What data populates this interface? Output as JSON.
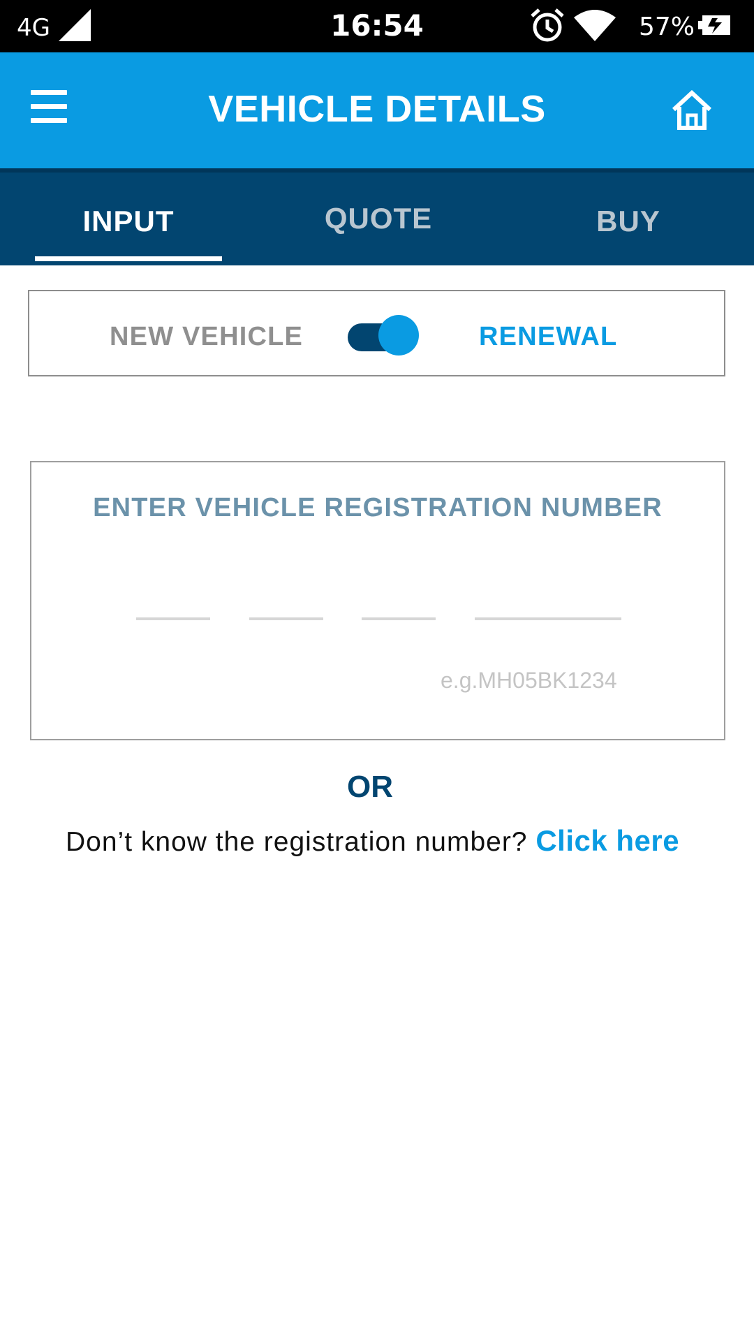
{
  "status_bar": {
    "network": "4G",
    "time": "16:54",
    "battery_percent": "57%",
    "icons": [
      "signal-icon",
      "alarm-icon",
      "wifi-icon",
      "battery-icon"
    ]
  },
  "app_bar": {
    "title": "VEHICLE DETAILS",
    "menu_icon": "menu-icon",
    "home_icon": "home-icon"
  },
  "tabs": [
    {
      "label": "INPUT",
      "active": true
    },
    {
      "label": "QUOTE",
      "active": false
    },
    {
      "label": "BUY",
      "active": false
    }
  ],
  "vehicle_type_toggle": {
    "left_label": "NEW VEHICLE",
    "right_label": "RENEWAL",
    "state": "RENEWAL"
  },
  "registration": {
    "heading": "ENTER VEHICLE REGISTRATION NUMBER",
    "fields": [
      "",
      "",
      "",
      ""
    ],
    "example": "e.g.MH05BK1234"
  },
  "alternate": {
    "or_text": "OR",
    "question": "Don’t know the registration number?",
    "link_label": "Click here"
  },
  "colors": {
    "primary": "#0a9be2",
    "dark": "#024570",
    "heading_muted": "#6b92aa"
  }
}
